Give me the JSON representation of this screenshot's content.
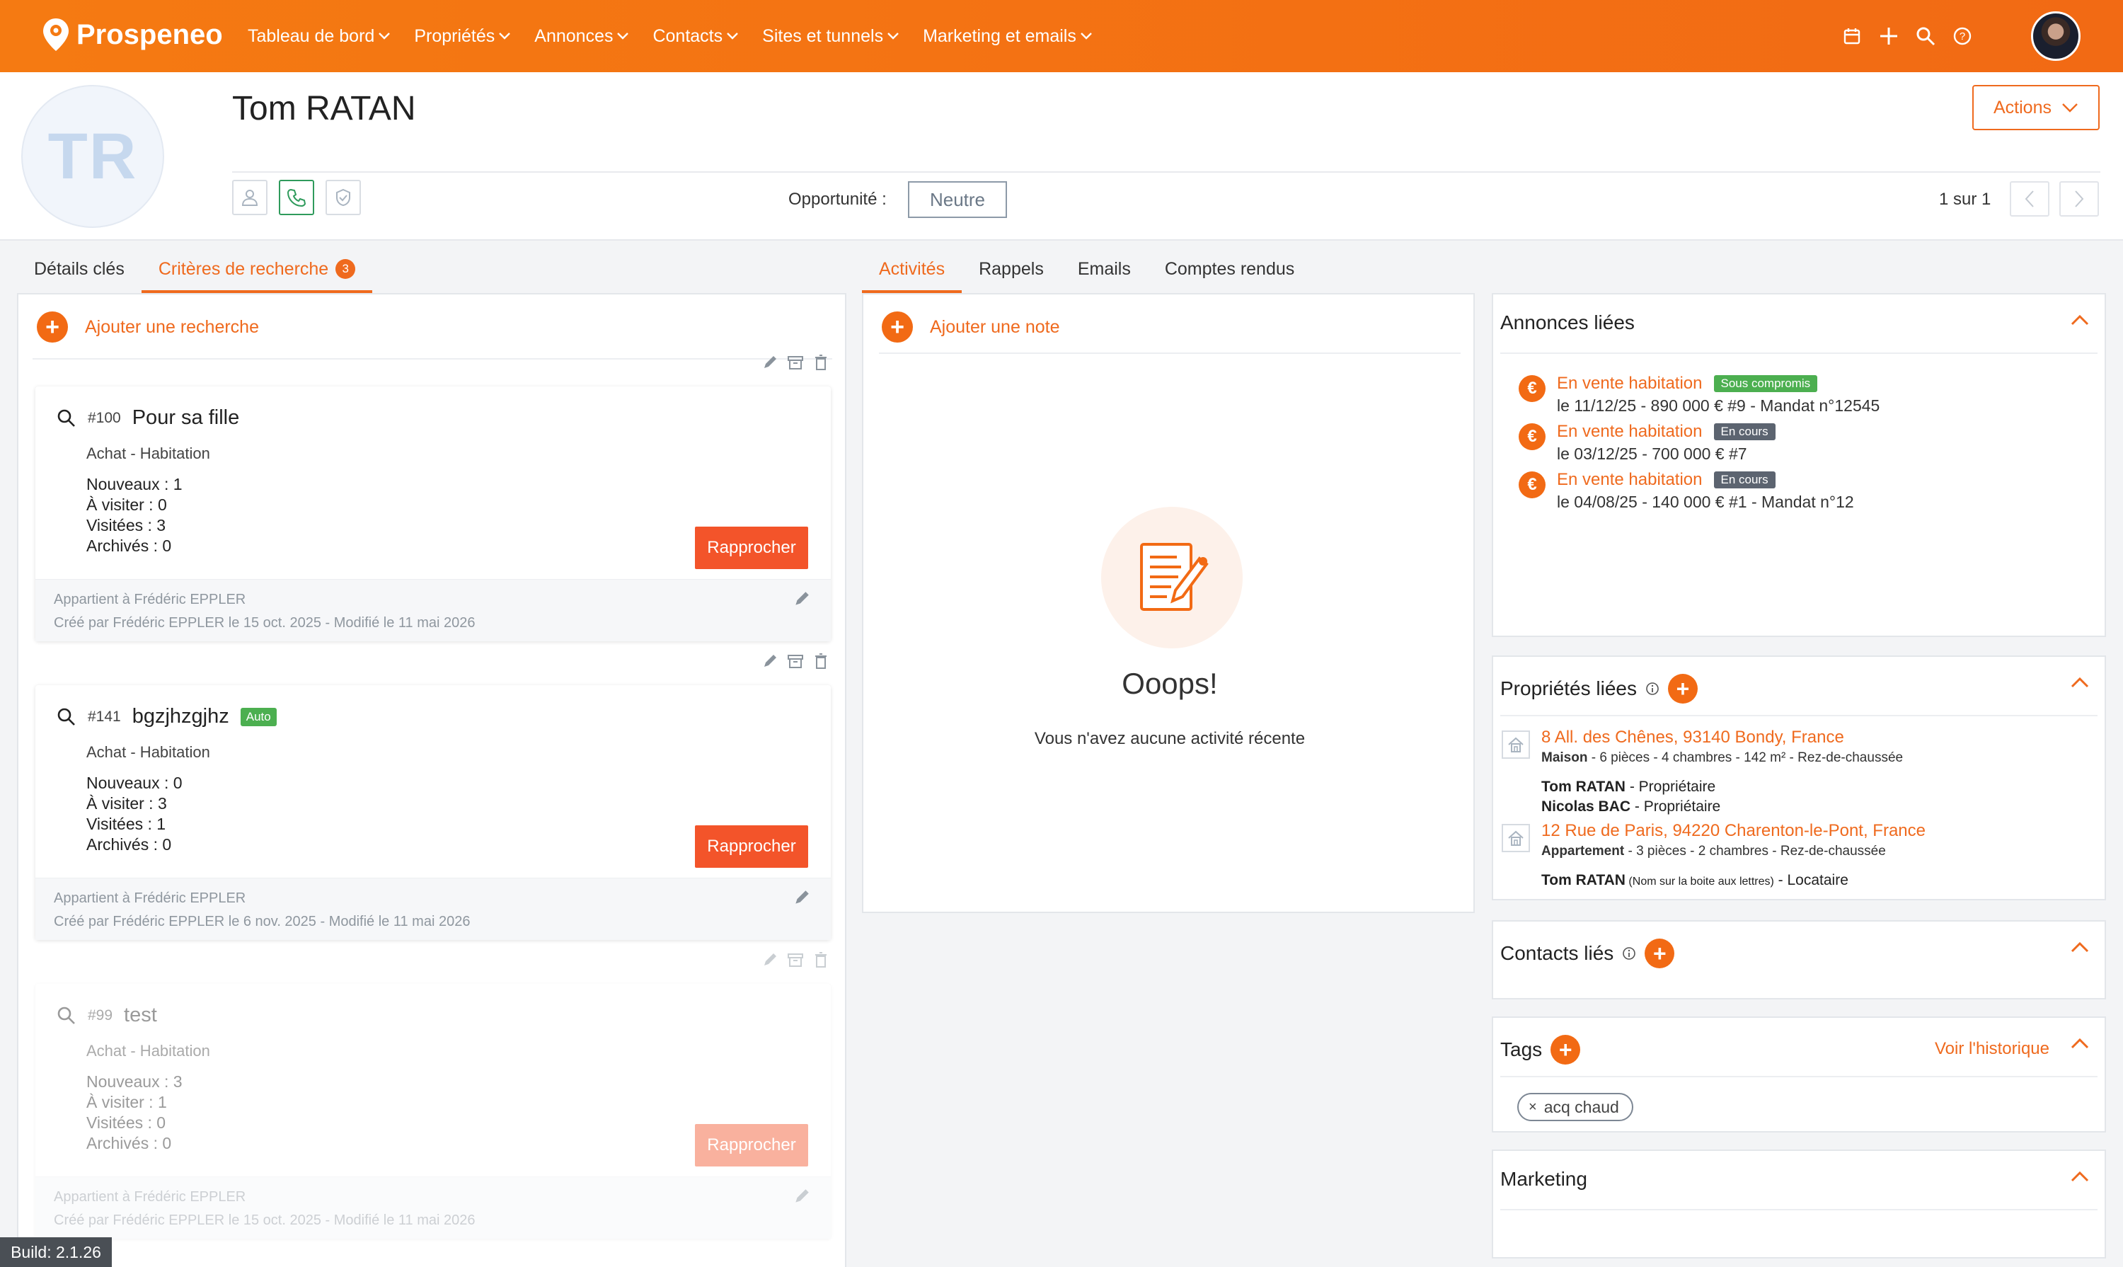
{
  "brand": {
    "name": "Prospeneo",
    "accent": "#f26a14"
  },
  "nav": [
    "Tableau de bord",
    "Propriétés",
    "Annonces",
    "Contacts",
    "Sites et tunnels",
    "Marketing et emails"
  ],
  "top_icons": [
    "calendar-icon",
    "plus-icon",
    "search-icon",
    "help-icon"
  ],
  "contact": {
    "initials": "TR",
    "name": "Tom RATAN"
  },
  "header": {
    "actions_label": "Actions",
    "opportunity_label": "Opportunité :",
    "opportunity_value": "Neutre",
    "pager": "1 sur 1"
  },
  "left_tabs": [
    {
      "label": "Détails clés"
    },
    {
      "label": "Critères de recherche",
      "badge": "3"
    }
  ],
  "left": {
    "add_label": "Ajouter une recherche",
    "searches": [
      {
        "num": "#100",
        "title": "Pour sa fille",
        "type": "Achat - Habitation",
        "stats": [
          "Nouveaux : 1",
          "À visiter : 0",
          "Visitées : 3",
          "Archivés : 0"
        ],
        "button": "Rapprocher",
        "owner": "Appartient à Frédéric EPPLER",
        "created": "Créé par Frédéric EPPLER le 15 oct. 2025 - Modifié le 11 mai 2026"
      },
      {
        "num": "#141",
        "title": "bgzjhzgjhz",
        "badge": "Auto",
        "type": "Achat - Habitation",
        "stats": [
          "Nouveaux : 0",
          "À visiter : 3",
          "Visitées : 1",
          "Archivés : 0"
        ],
        "button": "Rapprocher",
        "owner": "Appartient à Frédéric EPPLER",
        "created": "Créé par Frédéric EPPLER le 6 nov. 2025 - Modifié le 11 mai 2026"
      },
      {
        "num": "#99",
        "title": "test",
        "type": "Achat - Habitation",
        "stats": [
          "Nouveaux : 3",
          "À visiter : 1",
          "Visitées : 0",
          "Archivés : 0"
        ],
        "button": "Rapprocher",
        "owner": "Appartient à Frédéric EPPLER",
        "created": "Créé par Frédéric EPPLER le 15 oct. 2025 - Modifié le 11 mai 2026"
      }
    ]
  },
  "mid_tabs": [
    "Activités",
    "Rappels",
    "Emails",
    "Comptes rendus"
  ],
  "mid": {
    "add_label": "Ajouter une note",
    "empty_title": "Ooops!",
    "empty_text": "Vous n'avez aucune activité récente"
  },
  "annonces": {
    "title": "Annonces liées",
    "items": [
      {
        "title": "En vente habitation",
        "status": "Sous compromis",
        "status_color": "#4caf50",
        "detail": "le 11/12/25 - 890 000 € #9 - Mandat n°12545"
      },
      {
        "title": "En vente habitation",
        "status": "En cours",
        "status_color": "#5c6470",
        "detail": "le 03/12/25 - 700 000 € #7"
      },
      {
        "title": "En vente habitation",
        "status": "En cours",
        "status_color": "#5c6470",
        "detail": "le 04/08/25 - 140 000 € #1 - Mandat n°12"
      }
    ]
  },
  "proprietes": {
    "title": "Propriétés liées",
    "items": [
      {
        "address": "8 All. des Chênes, 93140 Bondy, France",
        "kind": "Maison",
        "desc": " - 6 pièces - 4 chambres - 142 m² - Rez-de-chaussée",
        "people": [
          {
            "name": "Tom RATAN",
            "note": "",
            "role": " - Propriétaire"
          },
          {
            "name": "Nicolas BAC",
            "note": "",
            "role": " - Propriétaire"
          }
        ]
      },
      {
        "address": "12 Rue de Paris, 94220 Charenton-le-Pont, France",
        "kind": "Appartement",
        "desc": " - 3 pièces - 2 chambres - Rez-de-chaussée",
        "people": [
          {
            "name": "Tom RATAN",
            "note": " (Nom sur la boite aux lettres)",
            "role": " - Locataire"
          }
        ]
      }
    ]
  },
  "contacts_lies": {
    "title": "Contacts liés"
  },
  "tags": {
    "title": "Tags",
    "history": "Voir l'historique",
    "items": [
      "acq chaud"
    ]
  },
  "marketing": {
    "title": "Marketing"
  },
  "build": "Build: 2.1.26"
}
